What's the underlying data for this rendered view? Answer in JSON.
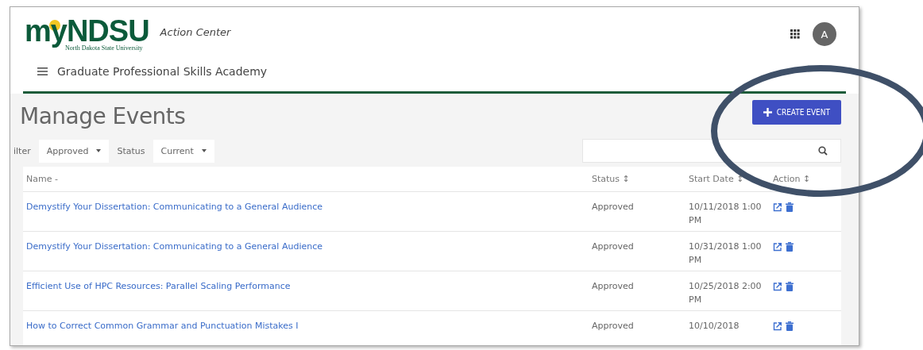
{
  "header": {
    "logo": "myNDSU",
    "logo_subtitle": "North Dakota State University",
    "app_name": "Action Center",
    "avatar": "A"
  },
  "nav": {
    "title": "Graduate Professional Skills Academy"
  },
  "page": {
    "title": "Manage Events",
    "create_button": "CREATE EVENT"
  },
  "filters": [
    {
      "label": "ilter",
      "value": "Approved"
    },
    {
      "label": "Status",
      "value": "Current"
    }
  ],
  "table": {
    "columns": [
      {
        "label": "Name",
        "sort": "-"
      },
      {
        "label": "Status",
        "sort": "↕"
      },
      {
        "label": "Start Date",
        "sort": "↕"
      },
      {
        "label": "Action",
        "sort": "↕"
      }
    ],
    "rows": [
      {
        "name": "Demystify Your Dissertation: Communicating to a General Audience",
        "status": "Approved",
        "start_date": "10/11/2018 1:00 PM"
      },
      {
        "name": "Demystify Your Dissertation: Communicating to a General Audience",
        "status": "Approved",
        "start_date": "10/31/2018 1:00 PM"
      },
      {
        "name": "Efficient Use of HPC Resources: Parallel Scaling Performance",
        "status": "Approved",
        "start_date": "10/25/2018 2:00 PM"
      },
      {
        "name": "How to Correct Common Grammar and Punctuation Mistakes I",
        "status": "Approved",
        "start_date": "10/10/2018"
      }
    ]
  }
}
